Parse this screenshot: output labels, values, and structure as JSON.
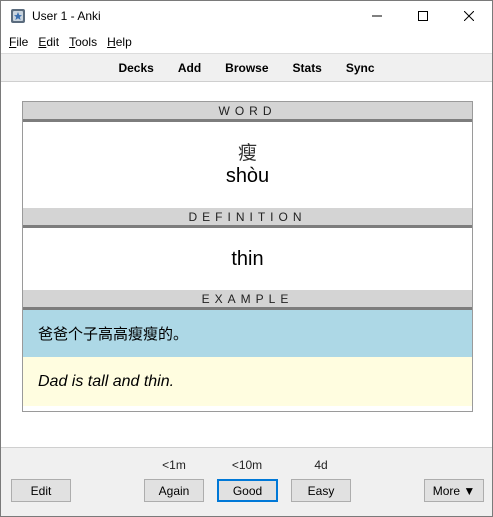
{
  "window": {
    "title": "User 1 - Anki"
  },
  "menu": [
    {
      "label": "File",
      "accel": "F",
      "rest": "ile"
    },
    {
      "label": "Edit",
      "accel": "E",
      "rest": "dit"
    },
    {
      "label": "Tools",
      "accel": "T",
      "rest": "ools"
    },
    {
      "label": "Help",
      "accel": "H",
      "rest": "elp"
    }
  ],
  "toolbar": {
    "decks": "Decks",
    "add": "Add",
    "browse": "Browse",
    "stats": "Stats",
    "sync": "Sync"
  },
  "card": {
    "word_header": "WORD",
    "hanzi": "瘦",
    "pinyin": "shòu",
    "definition_header": "DEFINITION",
    "definition": "thin",
    "example_header": "EXAMPLE",
    "example_zh": "爸爸个子高高瘦瘦的。",
    "example_en": "Dad is tall and thin."
  },
  "colors": {
    "example_zh_bg": "#add8e6",
    "example_en_bg": "#fffde0",
    "header_bg": "#d4d4d4",
    "focus": "#0078d7"
  },
  "bottom": {
    "edit": "Edit",
    "again_interval": "<1m",
    "again": "Again",
    "good_interval": "<10m",
    "good": "Good",
    "easy_interval": "4d",
    "easy": "Easy",
    "more": "More ▼"
  }
}
